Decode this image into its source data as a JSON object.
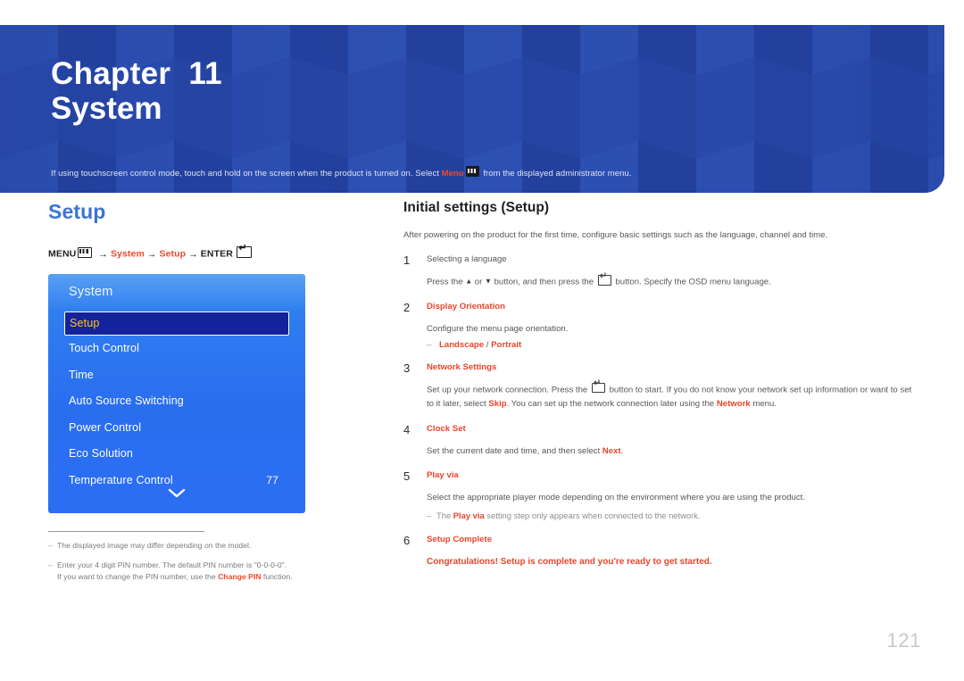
{
  "banner": {
    "chapter_word": "Chapter",
    "chapter_number": "11",
    "chapter_title": "System",
    "note_before": "If using touchscreen control mode, touch and hold on the screen when the product is turned on. Select ",
    "note_keyword": "Menu",
    "note_icon": "menu-icon",
    "note_after": " from the displayed administrator menu.",
    "background_color": "#2747a8"
  },
  "left": {
    "section_heading": "Setup",
    "section_heading_color": "#3b74d4",
    "menu_path": {
      "menu_label": "MENU",
      "menu_icon": "menu-icon",
      "arrow": "→",
      "step1": "System",
      "step2": "Setup",
      "enter_label": "ENTER",
      "enter_icon": "enter-icon",
      "keyword_color": "#f04a2a"
    },
    "osd": {
      "title": "System",
      "selected_text_color": "#ffc61a",
      "selected_bg_color": "#14229c",
      "items": [
        {
          "label": "Setup",
          "value": "",
          "selected": true
        },
        {
          "label": "Touch Control",
          "value": "",
          "selected": false
        },
        {
          "label": "Time",
          "value": "",
          "selected": false
        },
        {
          "label": "Auto Source Switching",
          "value": "",
          "selected": false
        },
        {
          "label": "Power Control",
          "value": "",
          "selected": false
        },
        {
          "label": "Eco Solution",
          "value": "",
          "selected": false
        },
        {
          "label": "Temperature Control",
          "value": "77",
          "selected": false
        }
      ],
      "scroll_icon": "chevron-down-icon"
    },
    "footnotes": [
      {
        "dash": "–",
        "text": "The displayed image may differ depending on the model."
      },
      {
        "dash": "–",
        "line1": "Enter your 4 digit PIN number. The default PIN number is \"0-0-0-0\".",
        "line2_before": "If you want to change the PIN number, use the ",
        "line2_keyword": "Change PIN",
        "line2_after": " function."
      }
    ]
  },
  "right": {
    "heading": "Initial settings (Setup)",
    "intro": "After powering on the product for the first time, configure basic settings such as the language, channel and time.",
    "steps": [
      {
        "num": "1",
        "title": "Selecting a language",
        "title_highlighted": false,
        "body_before": "Press the ",
        "body_mid1": " or ",
        "body_mid2": " button, and then press the ",
        "body_after": " button. Specify the OSD menu language."
      },
      {
        "num": "2",
        "title": "Display Orientation",
        "title_highlighted": true,
        "body": "Configure the menu page orientation.",
        "option_dash": "–",
        "option_a": "Landscape",
        "option_sep": " / ",
        "option_b": "Portrait"
      },
      {
        "num": "3",
        "title": "Network Settings",
        "title_highlighted": true,
        "body_p1": "Set up your network connection. Press the ",
        "body_p2": " button to start. If you do not know your network set up information or want to set to it later, select ",
        "body_kw1": "Skip",
        "body_p3": ". You can set up the network connection later using the ",
        "body_kw2": "Network",
        "body_p4": " menu."
      },
      {
        "num": "4",
        "title": "Clock Set",
        "title_highlighted": true,
        "body_before": "Set the current date and time, and then select ",
        "body_kw": "Next",
        "body_after": "."
      },
      {
        "num": "5",
        "title": "Play via",
        "title_highlighted": true,
        "body": "Select the appropriate player mode depending on the environment where you are using the product.",
        "note_dash": "–",
        "note_before": "The ",
        "note_kw": "Play via",
        "note_after": " setting step only appears when connected to the network."
      },
      {
        "num": "6",
        "title": "Setup Complete",
        "title_highlighted": true,
        "body_final": "Congratulations! Setup is complete and you're ready to get started."
      }
    ]
  },
  "page_number": "121"
}
